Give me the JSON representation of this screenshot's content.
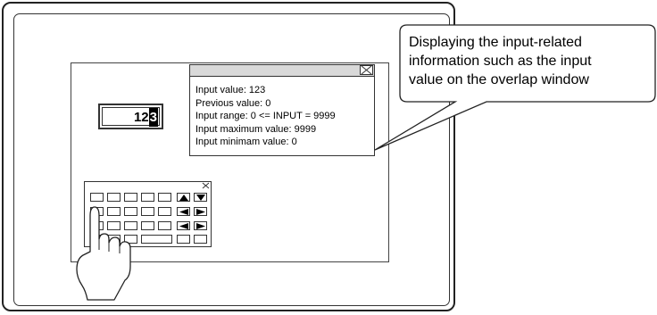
{
  "input_field": {
    "value": "12",
    "cursor_digit": "3"
  },
  "overlap_window": {
    "lines": [
      "Input value: 123",
      "Previous value: 0",
      "Input range: 0 <= INPUT = 9999",
      "Input maximum value: 9999",
      "Input minimam value: 0"
    ]
  },
  "callout": {
    "lines": [
      "Displaying the input-related",
      "information such as the input",
      "value on the overlap window"
    ]
  },
  "icons": {
    "close": "close-icon",
    "arrow_up": "arrow-up-icon",
    "arrow_down": "arrow-down-icon",
    "arrow_left": "arrow-left-icon",
    "arrow_right": "arrow-right-icon",
    "hand": "pointing-hand-icon"
  }
}
